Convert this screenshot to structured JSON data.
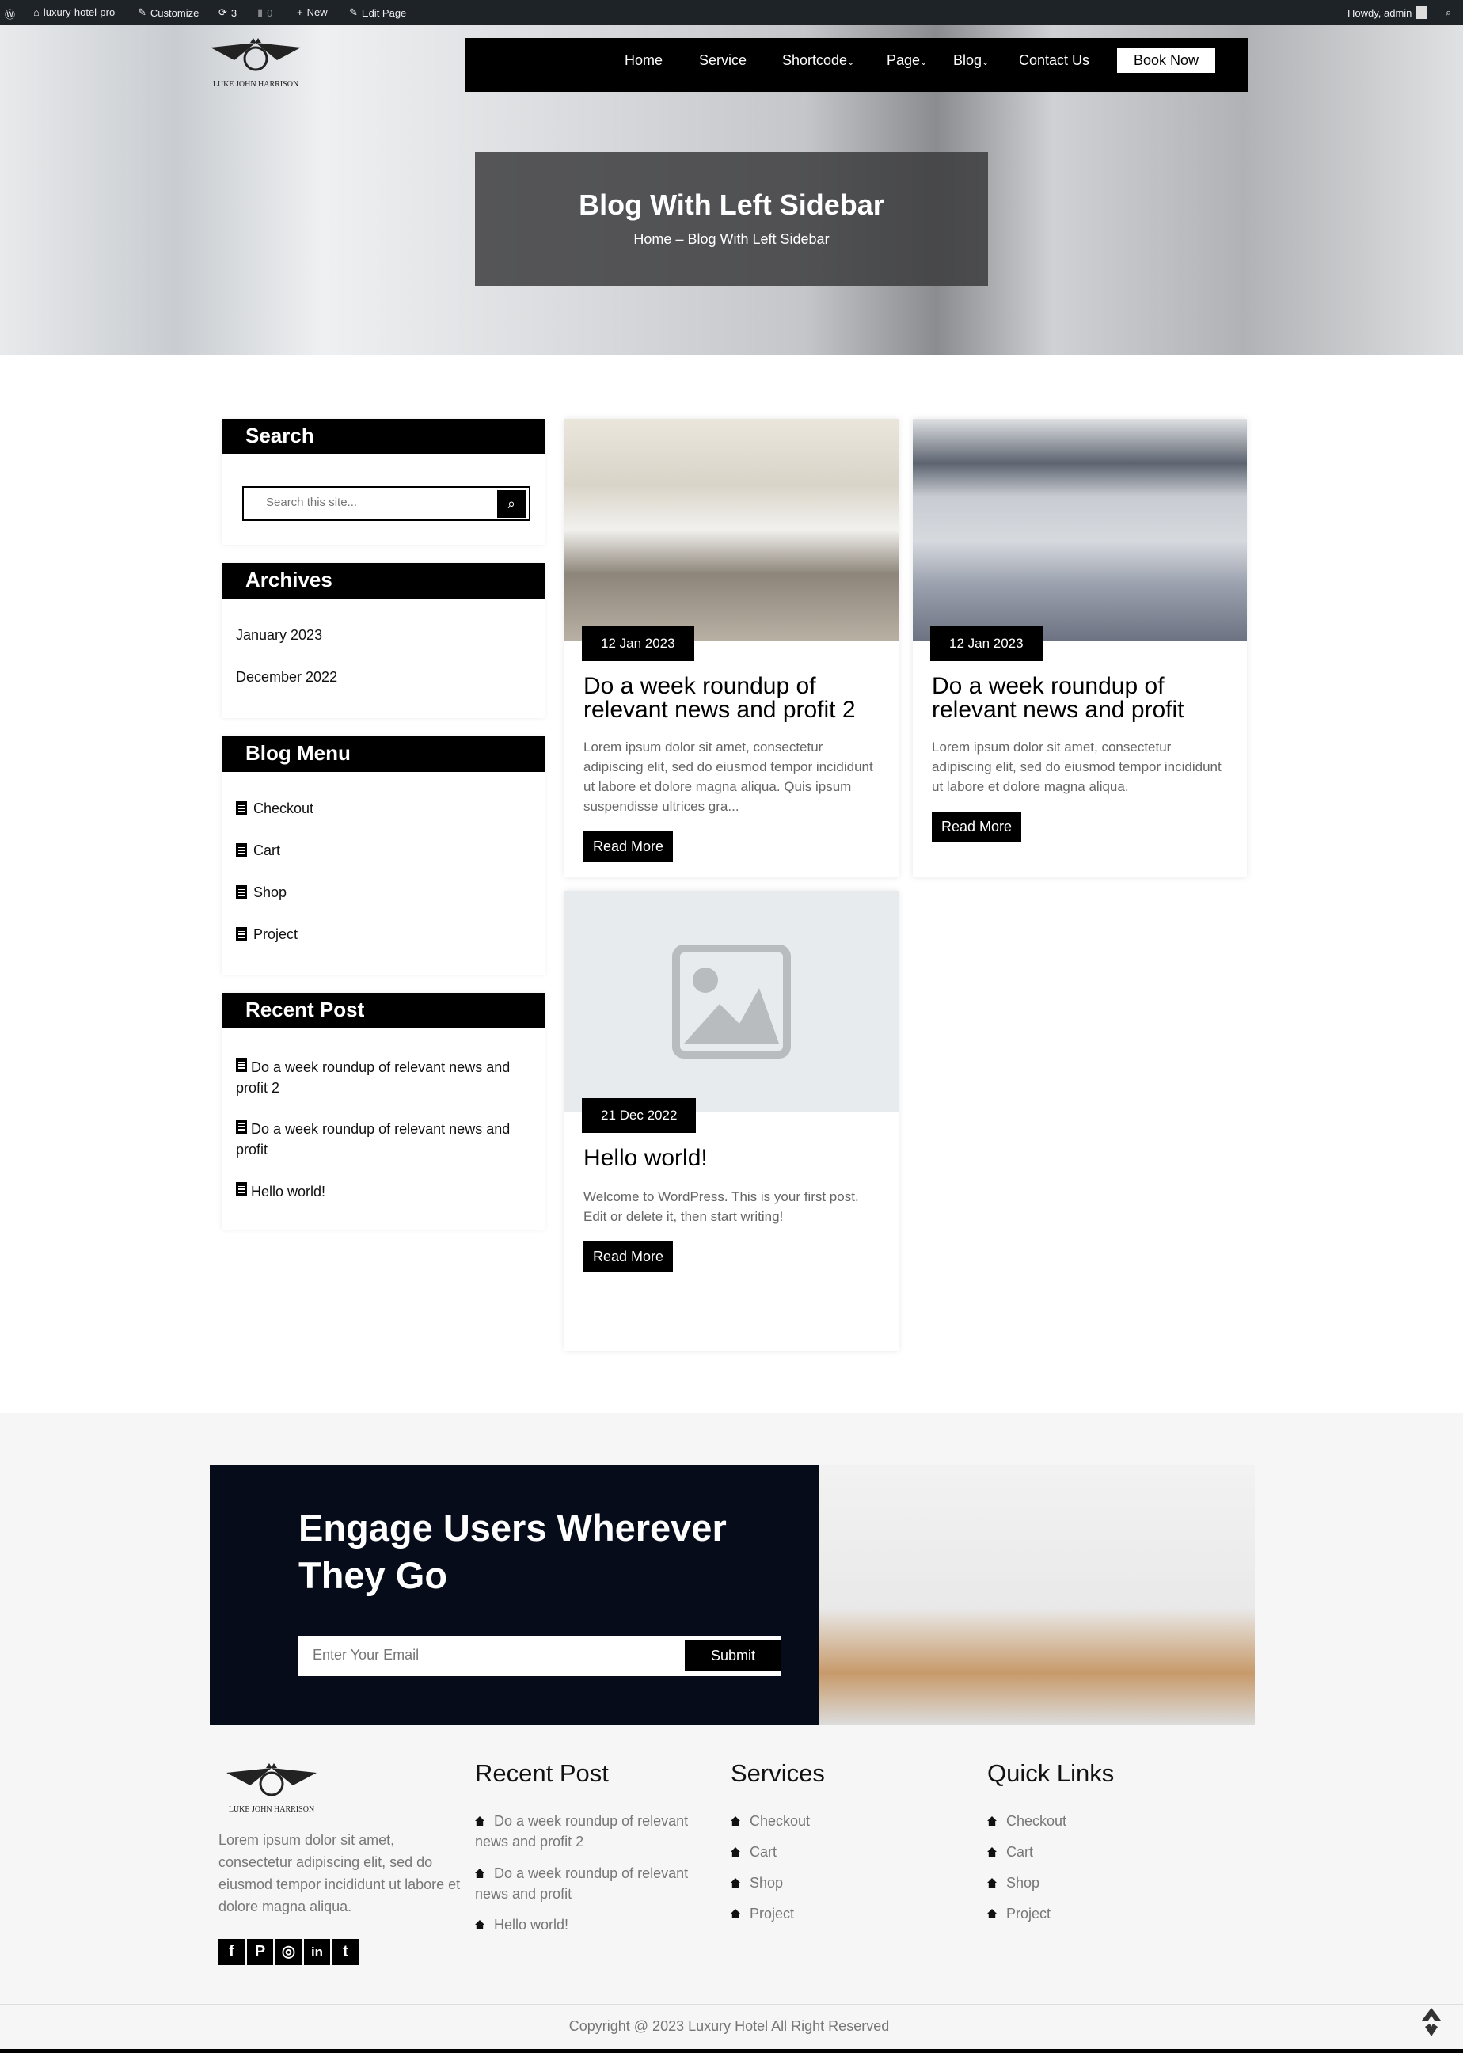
{
  "adminbar": {
    "site": "luxury-hotel-pro",
    "customize": "Customize",
    "updates": "3",
    "comments": "0",
    "new": "New",
    "edit": "Edit Page",
    "howdy": "Howdy, admin"
  },
  "logo_text": "LUKE JOHN HARRISON",
  "nav": {
    "items": [
      "Home",
      "Service",
      "Shortcode",
      "Page",
      "Blog",
      "Contact Us"
    ],
    "book": "Book Now"
  },
  "hero": {
    "title": "Blog With Left Sidebar",
    "breadcrumb_home": "Home",
    "breadcrumb_sep": "–",
    "breadcrumb_current": "Blog With Left Sidebar"
  },
  "sidebar": {
    "search": {
      "title": "Search",
      "placeholder": "Search this site..."
    },
    "archives": {
      "title": "Archives",
      "items": [
        "January 2023",
        "December 2022"
      ]
    },
    "blog_menu": {
      "title": "Blog Menu",
      "items": [
        "Checkout",
        "Cart",
        "Shop",
        "Project"
      ]
    },
    "recent": {
      "title": "Recent Post",
      "items": [
        "Do a week roundup of relevant news and profit 2",
        "Do a week roundup of relevant news and profit",
        "Hello world!"
      ]
    }
  },
  "posts": [
    {
      "date": "12 Jan 2023",
      "title": "Do a week roundup of relevant news and profit 2",
      "excerpt": "Lorem ipsum dolor sit amet, consectetur adipiscing elit, sed do eiusmod tempor incididunt ut labore et dolore magna aliqua. Quis ipsum suspendisse ultrices gra...",
      "read_more": "Read More"
    },
    {
      "date": "12 Jan 2023",
      "title": "Do a week roundup of relevant news and profit",
      "excerpt": "Lorem ipsum dolor sit amet, consectetur adipiscing elit, sed do eiusmod tempor incididunt ut labore et dolore magna aliqua.",
      "read_more": "Read More"
    },
    {
      "date": "21 Dec 2022",
      "title": "Hello world!",
      "excerpt": "Welcome to WordPress. This is your first post. Edit or delete it, then start writing!",
      "read_more": "Read More"
    }
  ],
  "newsletter": {
    "title": "Engage Users Wherever They Go",
    "placeholder": "Enter Your Email",
    "submit": "Submit"
  },
  "footer": {
    "about": "Lorem ipsum dolor sit amet, consectetur adipiscing elit, sed do eiusmod tempor incididunt ut labore et dolore magna aliqua.",
    "social": [
      "facebook",
      "pinterest",
      "instagram",
      "linkedin",
      "twitter"
    ],
    "recent": {
      "title": "Recent Post",
      "items": [
        "Do a week roundup of relevant news and profit 2",
        "Do a week roundup of relevant news and profit",
        "Hello world!"
      ]
    },
    "services": {
      "title": "Services",
      "items": [
        "Checkout",
        "Cart",
        "Shop",
        "Project"
      ]
    },
    "quick": {
      "title": "Quick Links",
      "items": [
        "Checkout",
        "Cart",
        "Shop",
        "Project"
      ]
    },
    "copyright": "Copyright @ 2023 Luxury Hotel All Right Reserved"
  }
}
